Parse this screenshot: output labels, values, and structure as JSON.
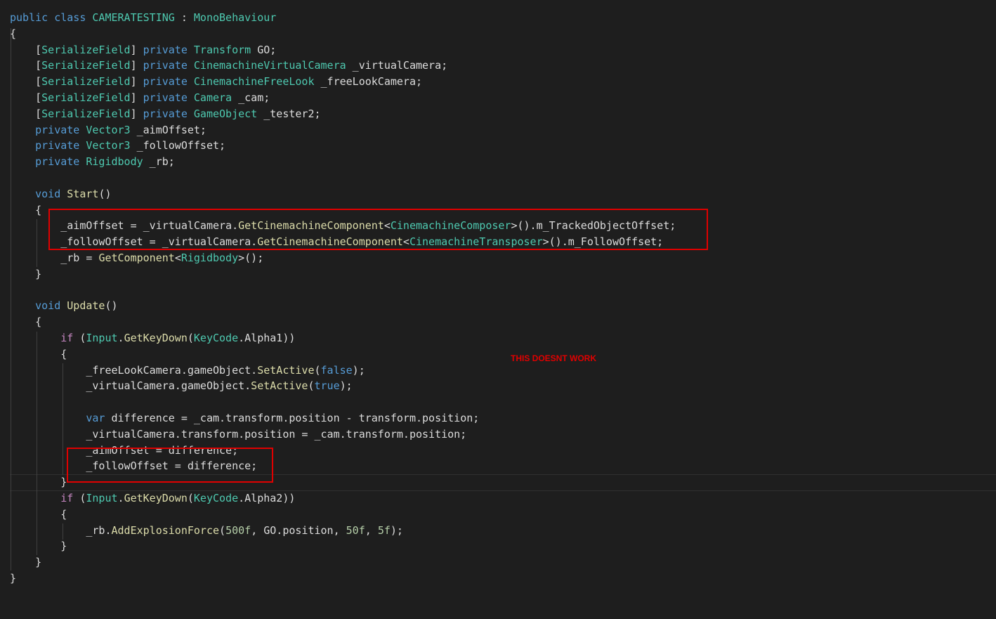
{
  "code_lines": [
    [
      [
        "kw",
        "public"
      ],
      [
        "pl",
        " "
      ],
      [
        "kw",
        "class"
      ],
      [
        "pl",
        " "
      ],
      [
        "ty",
        "CAMERATESTING"
      ],
      [
        "pl",
        " : "
      ],
      [
        "ty",
        "MonoBehaviour"
      ]
    ],
    [
      [
        "pl",
        "{"
      ]
    ],
    [
      [
        "pl",
        "    ["
      ],
      [
        "ty",
        "SerializeField"
      ],
      [
        "pl",
        "] "
      ],
      [
        "kw",
        "private"
      ],
      [
        "pl",
        " "
      ],
      [
        "ty",
        "Transform"
      ],
      [
        "pl",
        " GO;"
      ]
    ],
    [
      [
        "pl",
        "    ["
      ],
      [
        "ty",
        "SerializeField"
      ],
      [
        "pl",
        "] "
      ],
      [
        "kw",
        "private"
      ],
      [
        "pl",
        " "
      ],
      [
        "ty",
        "CinemachineVirtualCamera"
      ],
      [
        "pl",
        " _virtualCamera;"
      ]
    ],
    [
      [
        "pl",
        "    ["
      ],
      [
        "ty",
        "SerializeField"
      ],
      [
        "pl",
        "] "
      ],
      [
        "kw",
        "private"
      ],
      [
        "pl",
        " "
      ],
      [
        "ty",
        "CinemachineFreeLook"
      ],
      [
        "pl",
        " _freeLookCamera;"
      ]
    ],
    [
      [
        "pl",
        "    ["
      ],
      [
        "ty",
        "SerializeField"
      ],
      [
        "pl",
        "] "
      ],
      [
        "kw",
        "private"
      ],
      [
        "pl",
        " "
      ],
      [
        "ty",
        "Camera"
      ],
      [
        "pl",
        " _cam;"
      ]
    ],
    [
      [
        "pl",
        "    ["
      ],
      [
        "ty",
        "SerializeField"
      ],
      [
        "pl",
        "] "
      ],
      [
        "kw",
        "private"
      ],
      [
        "pl",
        " "
      ],
      [
        "ty",
        "GameObject"
      ],
      [
        "pl",
        " _tester2;"
      ]
    ],
    [
      [
        "pl",
        "    "
      ],
      [
        "kw",
        "private"
      ],
      [
        "pl",
        " "
      ],
      [
        "ty",
        "Vector3"
      ],
      [
        "pl",
        " _aimOffset;"
      ]
    ],
    [
      [
        "pl",
        "    "
      ],
      [
        "kw",
        "private"
      ],
      [
        "pl",
        " "
      ],
      [
        "ty",
        "Vector3"
      ],
      [
        "pl",
        " _followOffset;"
      ]
    ],
    [
      [
        "pl",
        "    "
      ],
      [
        "kw",
        "private"
      ],
      [
        "pl",
        " "
      ],
      [
        "ty",
        "Rigidbody"
      ],
      [
        "pl",
        " _rb;"
      ]
    ],
    [],
    [
      [
        "pl",
        "    "
      ],
      [
        "kw",
        "void"
      ],
      [
        "pl",
        " "
      ],
      [
        "fn",
        "Start"
      ],
      [
        "pl",
        "()"
      ]
    ],
    [
      [
        "pl",
        "    {"
      ]
    ],
    [
      [
        "pl",
        "        _aimOffset = _virtualCamera."
      ],
      [
        "fn",
        "GetCinemachineComponent"
      ],
      [
        "pl",
        "<"
      ],
      [
        "ty",
        "CinemachineComposer"
      ],
      [
        "pl",
        ">()."
      ],
      [
        "pl",
        "m_TrackedObjectOffset;"
      ]
    ],
    [
      [
        "pl",
        "        _followOffset = _virtualCamera."
      ],
      [
        "fn",
        "GetCinemachineComponent"
      ],
      [
        "pl",
        "<"
      ],
      [
        "ty",
        "CinemachineTransposer"
      ],
      [
        "pl",
        ">()."
      ],
      [
        "pl",
        "m_FollowOffset;"
      ]
    ],
    [
      [
        "pl",
        "        _rb = "
      ],
      [
        "fn",
        "GetComponent"
      ],
      [
        "pl",
        "<"
      ],
      [
        "ty",
        "Rigidbody"
      ],
      [
        "pl",
        ">();"
      ]
    ],
    [
      [
        "pl",
        "    }"
      ]
    ],
    [],
    [
      [
        "pl",
        "    "
      ],
      [
        "kw",
        "void"
      ],
      [
        "pl",
        " "
      ],
      [
        "fn",
        "Update"
      ],
      [
        "pl",
        "()"
      ]
    ],
    [
      [
        "pl",
        "    {"
      ]
    ],
    [
      [
        "pl",
        "        "
      ],
      [
        "ctl",
        "if"
      ],
      [
        "pl",
        " ("
      ],
      [
        "ty",
        "Input"
      ],
      [
        "pl",
        "."
      ],
      [
        "fn",
        "GetKeyDown"
      ],
      [
        "pl",
        "("
      ],
      [
        "ty",
        "KeyCode"
      ],
      [
        "pl",
        ".Alpha1))"
      ]
    ],
    [
      [
        "pl",
        "        {"
      ]
    ],
    [
      [
        "pl",
        "            _freeLookCamera.gameObject."
      ],
      [
        "fn",
        "SetActive"
      ],
      [
        "pl",
        "("
      ],
      [
        "kw",
        "false"
      ],
      [
        "pl",
        ");"
      ]
    ],
    [
      [
        "pl",
        "            _virtualCamera.gameObject."
      ],
      [
        "fn",
        "SetActive"
      ],
      [
        "pl",
        "("
      ],
      [
        "kw",
        "true"
      ],
      [
        "pl",
        ");"
      ]
    ],
    [],
    [
      [
        "pl",
        "            "
      ],
      [
        "kw",
        "var"
      ],
      [
        "pl",
        " difference = _cam.transform.position - transform.position;"
      ]
    ],
    [
      [
        "pl",
        "            _virtualCamera.transform.position = _cam.transform.position;"
      ]
    ],
    [
      [
        "pl",
        "            _aimOffset = difference;"
      ]
    ],
    [
      [
        "pl",
        "            _followOffset = difference;"
      ]
    ],
    [
      [
        "pl",
        "        }"
      ]
    ],
    [
      [
        "pl",
        "        "
      ],
      [
        "ctl",
        "if"
      ],
      [
        "pl",
        " ("
      ],
      [
        "ty",
        "Input"
      ],
      [
        "pl",
        "."
      ],
      [
        "fn",
        "GetKeyDown"
      ],
      [
        "pl",
        "("
      ],
      [
        "ty",
        "KeyCode"
      ],
      [
        "pl",
        ".Alpha2))"
      ]
    ],
    [
      [
        "pl",
        "        {"
      ]
    ],
    [
      [
        "pl",
        "            _rb."
      ],
      [
        "fn",
        "AddExplosionForce"
      ],
      [
        "pl",
        "("
      ],
      [
        "num",
        "500f"
      ],
      [
        "pl",
        ", GO.position, "
      ],
      [
        "num",
        "50f"
      ],
      [
        "pl",
        ", "
      ],
      [
        "num",
        "5f"
      ],
      [
        "pl",
        ");"
      ]
    ],
    [
      [
        "pl",
        "        }"
      ]
    ],
    [
      [
        "pl",
        "    }"
      ]
    ],
    [
      [
        "pl",
        "}"
      ]
    ]
  ],
  "annotation": {
    "text": "THIS DOESNT WORK",
    "color": "#e00000"
  },
  "colors": {
    "background": "#1e1e1e",
    "keyword": "#569cd6",
    "type": "#4ec9b0",
    "method": "#dcdcaa",
    "plain": "#dcdcdc",
    "control": "#c586c0",
    "number": "#b5cea8"
  }
}
